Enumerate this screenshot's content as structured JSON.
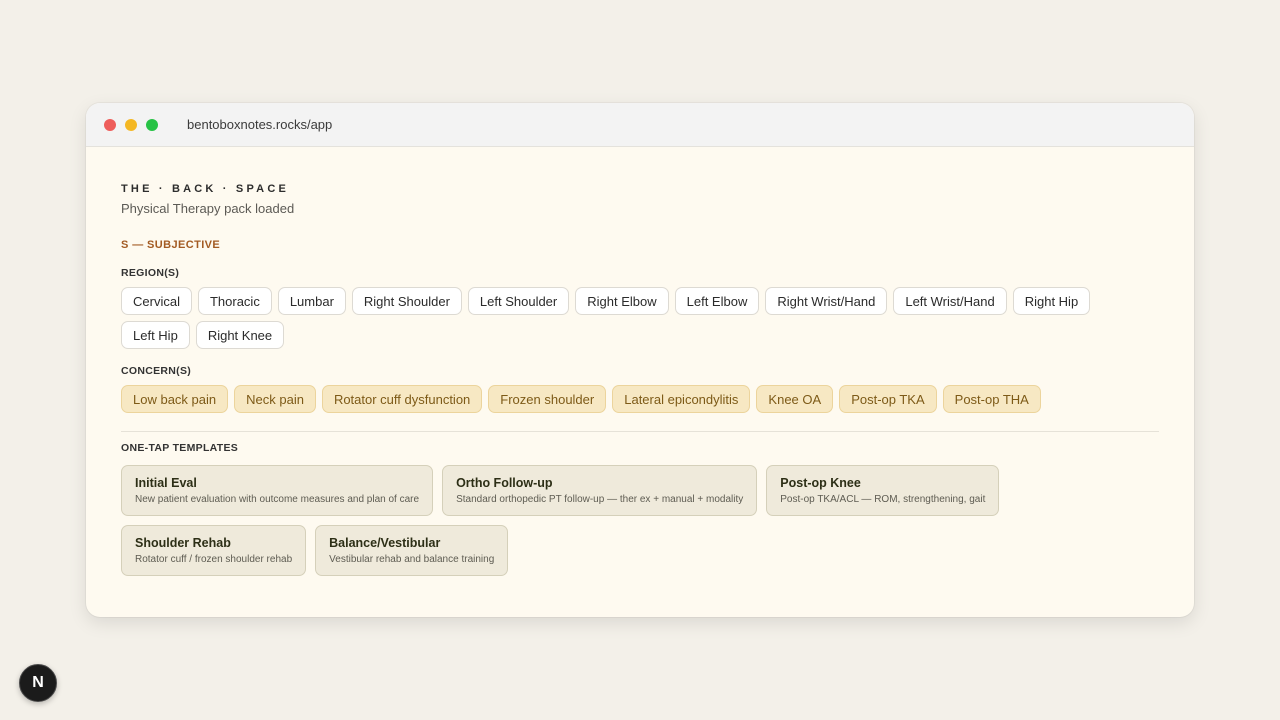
{
  "browser": {
    "url": "bentoboxnotes.rocks/app"
  },
  "app": {
    "brand": "THE · BACK · SPACE",
    "subtitle": "Physical Therapy pack loaded"
  },
  "subjective": {
    "section_title": "S — SUBJECTIVE",
    "region_label": "REGION(S)",
    "regions": [
      "Cervical",
      "Thoracic",
      "Lumbar",
      "Right Shoulder",
      "Left Shoulder",
      "Right Elbow",
      "Left Elbow",
      "Right Wrist/Hand",
      "Left Wrist/Hand",
      "Right Hip",
      "Left Hip",
      "Right Knee"
    ],
    "concern_label": "CONCERN(S)",
    "concerns": [
      "Low back pain",
      "Neck pain",
      "Rotator cuff dysfunction",
      "Frozen shoulder",
      "Lateral epicondylitis",
      "Knee OA",
      "Post-op TKA",
      "Post-op THA"
    ]
  },
  "templates": {
    "label": "ONE-TAP TEMPLATES",
    "items": [
      {
        "name": "Initial Eval",
        "desc": "New patient evaluation with outcome measures and plan of care"
      },
      {
        "name": "Ortho Follow-up",
        "desc": "Standard orthopedic PT follow-up — ther ex + manual + modality"
      },
      {
        "name": "Post-op Knee",
        "desc": "Post-op TKA/ACL — ROM, strengthening, gait"
      },
      {
        "name": "Shoulder Rehab",
        "desc": "Rotator cuff / frozen shoulder rehab"
      },
      {
        "name": "Balance/Vestibular",
        "desc": "Vestibular rehab and balance training"
      }
    ]
  },
  "badge": {
    "letter": "N"
  },
  "colors": {
    "accent": "#a35b23",
    "concern_chip": "#f7e8c3",
    "template_card": "#efeadb",
    "page_bg": "#f3f0e9"
  }
}
